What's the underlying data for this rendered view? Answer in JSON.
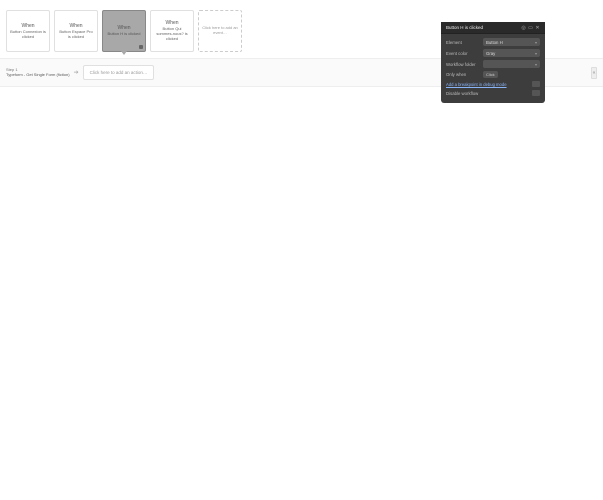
{
  "events": {
    "when_label": "When",
    "cards": [
      {
        "desc": "Button Connexion is clicked"
      },
      {
        "desc": "Button Espace Pro is clicked"
      },
      {
        "desc": "Button H is clicked"
      },
      {
        "desc": "Button Qui sommes-nous? is clicked"
      }
    ],
    "add_card": "Click here to add an event…"
  },
  "steps": {
    "step1_label": "Step 1",
    "step1_desc": "Typeform - Get Single Form (fiction)",
    "add_action": "Click here to add an action…"
  },
  "panel": {
    "title": "Button H is clicked",
    "rows": {
      "element_label": "Element",
      "element_value": "Button H",
      "color_label": "Event color",
      "color_value": "Gray",
      "folder_label": "Workflow folder",
      "folder_value": "",
      "only_when_label": "Only when",
      "only_when_action": "Click",
      "breakpoint": "Add a breakpoint in debug mode",
      "disable": "Disable workflow"
    }
  }
}
